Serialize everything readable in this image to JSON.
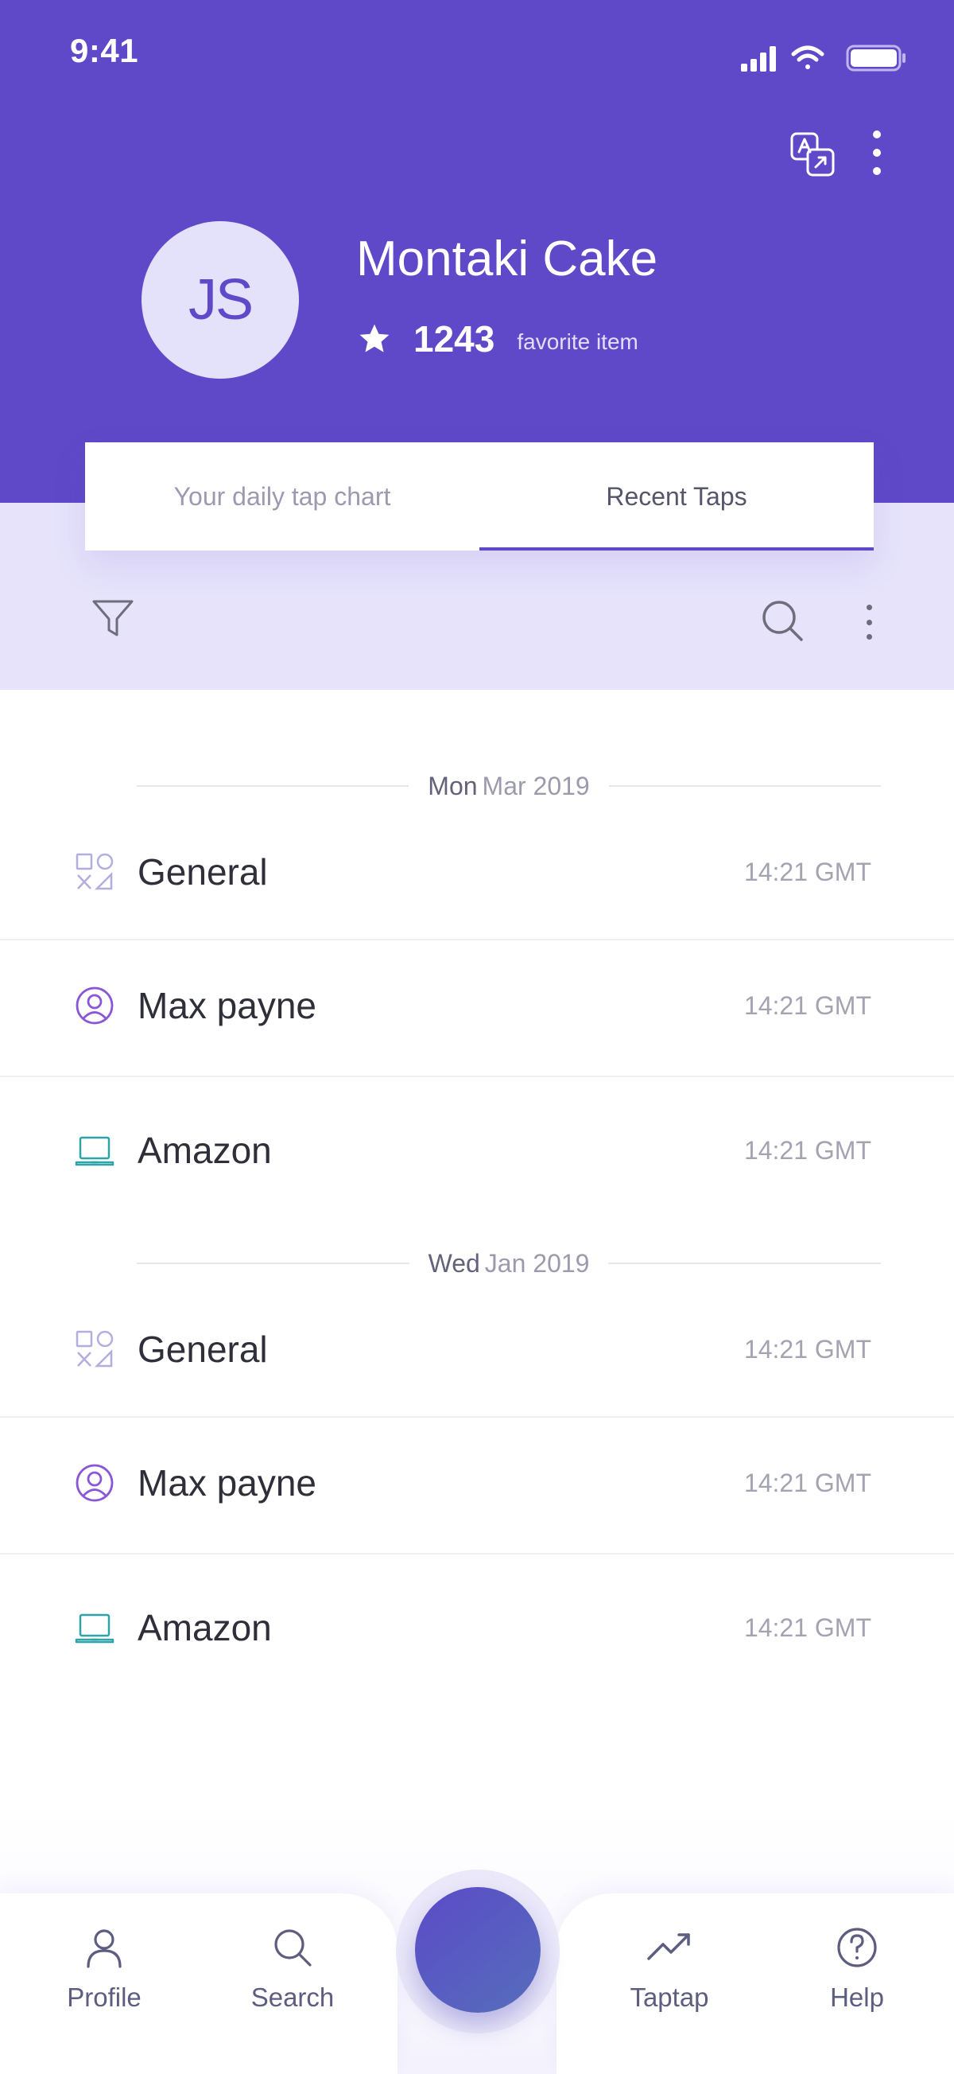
{
  "status_bar": {
    "time": "9:41"
  },
  "profile": {
    "initials": "JS",
    "name": "Montaki Cake",
    "favorite_count": "1243",
    "favorite_label": "favorite item"
  },
  "tabs": [
    {
      "label": "Your daily tap chart",
      "active": false
    },
    {
      "label": "Recent Taps",
      "active": true
    }
  ],
  "groups": [
    {
      "day": "Mon",
      "date": "Mar 2019",
      "items": [
        {
          "icon": "shapes-icon",
          "title": "General",
          "time": "14:21 GMT"
        },
        {
          "icon": "user-circle-icon",
          "title": "Max payne",
          "time": "14:21 GMT"
        },
        {
          "icon": "laptop-icon",
          "title": "Amazon",
          "time": "14:21 GMT"
        }
      ]
    },
    {
      "day": "Wed",
      "date": "Jan 2019",
      "items": [
        {
          "icon": "shapes-icon",
          "title": "General",
          "time": "14:21 GMT"
        },
        {
          "icon": "user-circle-icon",
          "title": "Max payne",
          "time": "14:21 GMT"
        },
        {
          "icon": "laptop-icon",
          "title": "Amazon",
          "time": "14:21 GMT"
        }
      ]
    }
  ],
  "bottom_nav": [
    {
      "icon": "person-icon",
      "label": "Profile"
    },
    {
      "icon": "search-icon",
      "label": "Search"
    },
    {
      "icon": "trend-up-icon",
      "label": "Taptap"
    },
    {
      "icon": "help-icon",
      "label": "Help"
    }
  ],
  "colors": {
    "primary": "#5f49c9",
    "lavender": "#e6e3fb",
    "icon_teal": "#2ea3a8",
    "icon_purple": "#8a55d6",
    "icon_lavender": "#b3aee0"
  }
}
